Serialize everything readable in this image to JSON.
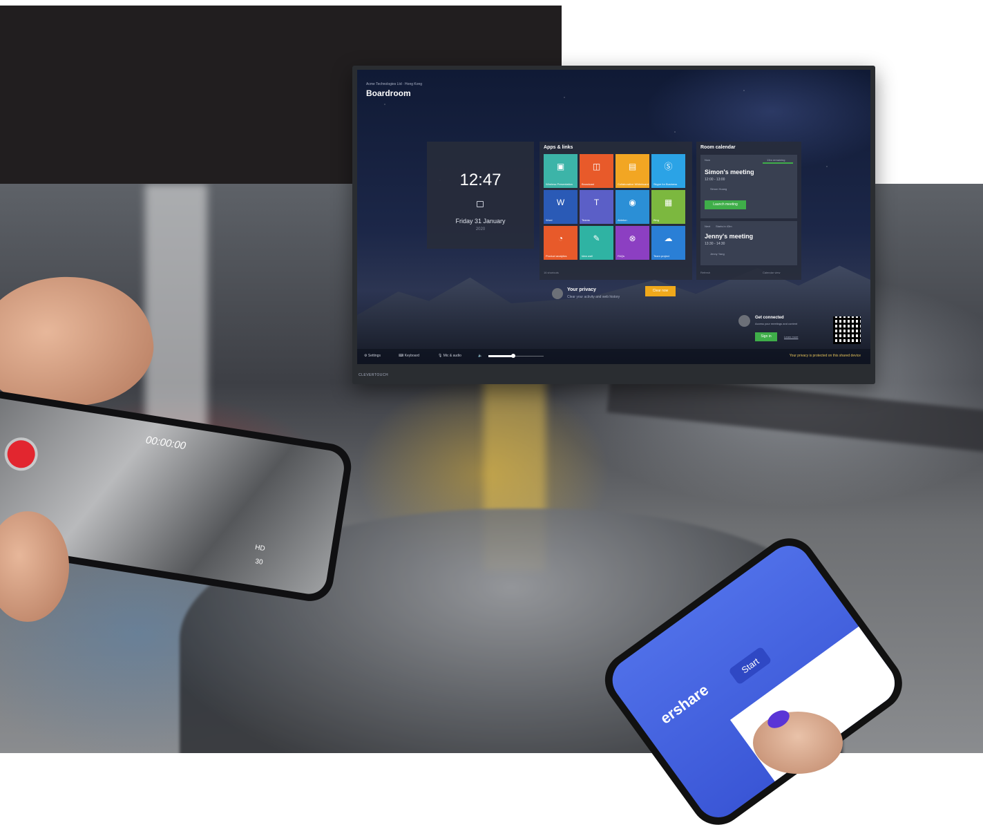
{
  "display": {
    "org": "Acme Technologies Ltd · Hong Kong",
    "room": "Boardroom",
    "clock": {
      "time": "12:47",
      "date": "Friday 31 January",
      "year": "2020"
    },
    "apps": {
      "heading": "Apps & links",
      "footer": "16 shortcuts",
      "tiles": [
        {
          "label": "Wireless Presentation",
          "color": "#3cb4a8",
          "icon": "presentation-icon"
        },
        {
          "label": "Broadcast",
          "color": "#e85a2a",
          "icon": "broadcast-icon"
        },
        {
          "label": "Collaborative Whiteboard",
          "color": "#f2a623",
          "icon": "whiteboard-icon"
        },
        {
          "label": "Skype for Business",
          "color": "#2ba3e6",
          "icon": "skype-icon"
        },
        {
          "label": "Word",
          "color": "#2a5ab6",
          "icon": "word-icon"
        },
        {
          "label": "Teams",
          "color": "#5b5fc7",
          "icon": "teams-icon"
        },
        {
          "label": "Ableton",
          "color": "#2b8fd6",
          "icon": "globe-icon"
        },
        {
          "label": "Bing",
          "color": "#7cb83f",
          "icon": "bing-icon"
        },
        {
          "label": "Product analytics",
          "color": "#e85a2a",
          "icon": "pie-chart-icon"
        },
        {
          "label": "Idea wall",
          "color": "#2fb3a3",
          "icon": "pencil-icon"
        },
        {
          "label": "FAQs",
          "color": "#8c3fc2",
          "icon": "lifebuoy-icon"
        },
        {
          "label": "Team project",
          "color": "#2a7fd6",
          "icon": "cloud-icon"
        }
      ]
    },
    "calendar": {
      "heading": "Room calendar",
      "now_label": "Now",
      "remaining": "13m remaining",
      "current": {
        "title": "Simon's meeting",
        "time": "12:00 - 13:00",
        "host": "Simon Hoang",
        "button": "Launch meeting"
      },
      "next_label": "Next",
      "next_in": "Starts in 43m",
      "next": {
        "title": "Jenny's meeting",
        "time": "13:30 - 14:30",
        "host": "Jenny Yang"
      },
      "refresh": "Refresh",
      "footer_right": "Calendar view"
    },
    "privacy": {
      "title": "Your privacy",
      "subtitle": "Clear your activity and web history",
      "button": "Clear now"
    },
    "connect": {
      "title": "Get connected",
      "subtitle": "Access your meetings and content",
      "button": "Sign in",
      "link": "Learn more"
    },
    "toolbar": {
      "settings": "Settings",
      "keyboard": "Keyboard",
      "mic": "Mic & audio",
      "volume": 0.45,
      "privacy_note": "Your privacy is protected on this shared device"
    },
    "brand": "CLEVERTOUCH"
  },
  "phone_left": {
    "recording_time": "00:00:00",
    "res": "HD",
    "fps": "30"
  },
  "phone_right": {
    "app_label": "ershare",
    "start_button": "Start"
  }
}
